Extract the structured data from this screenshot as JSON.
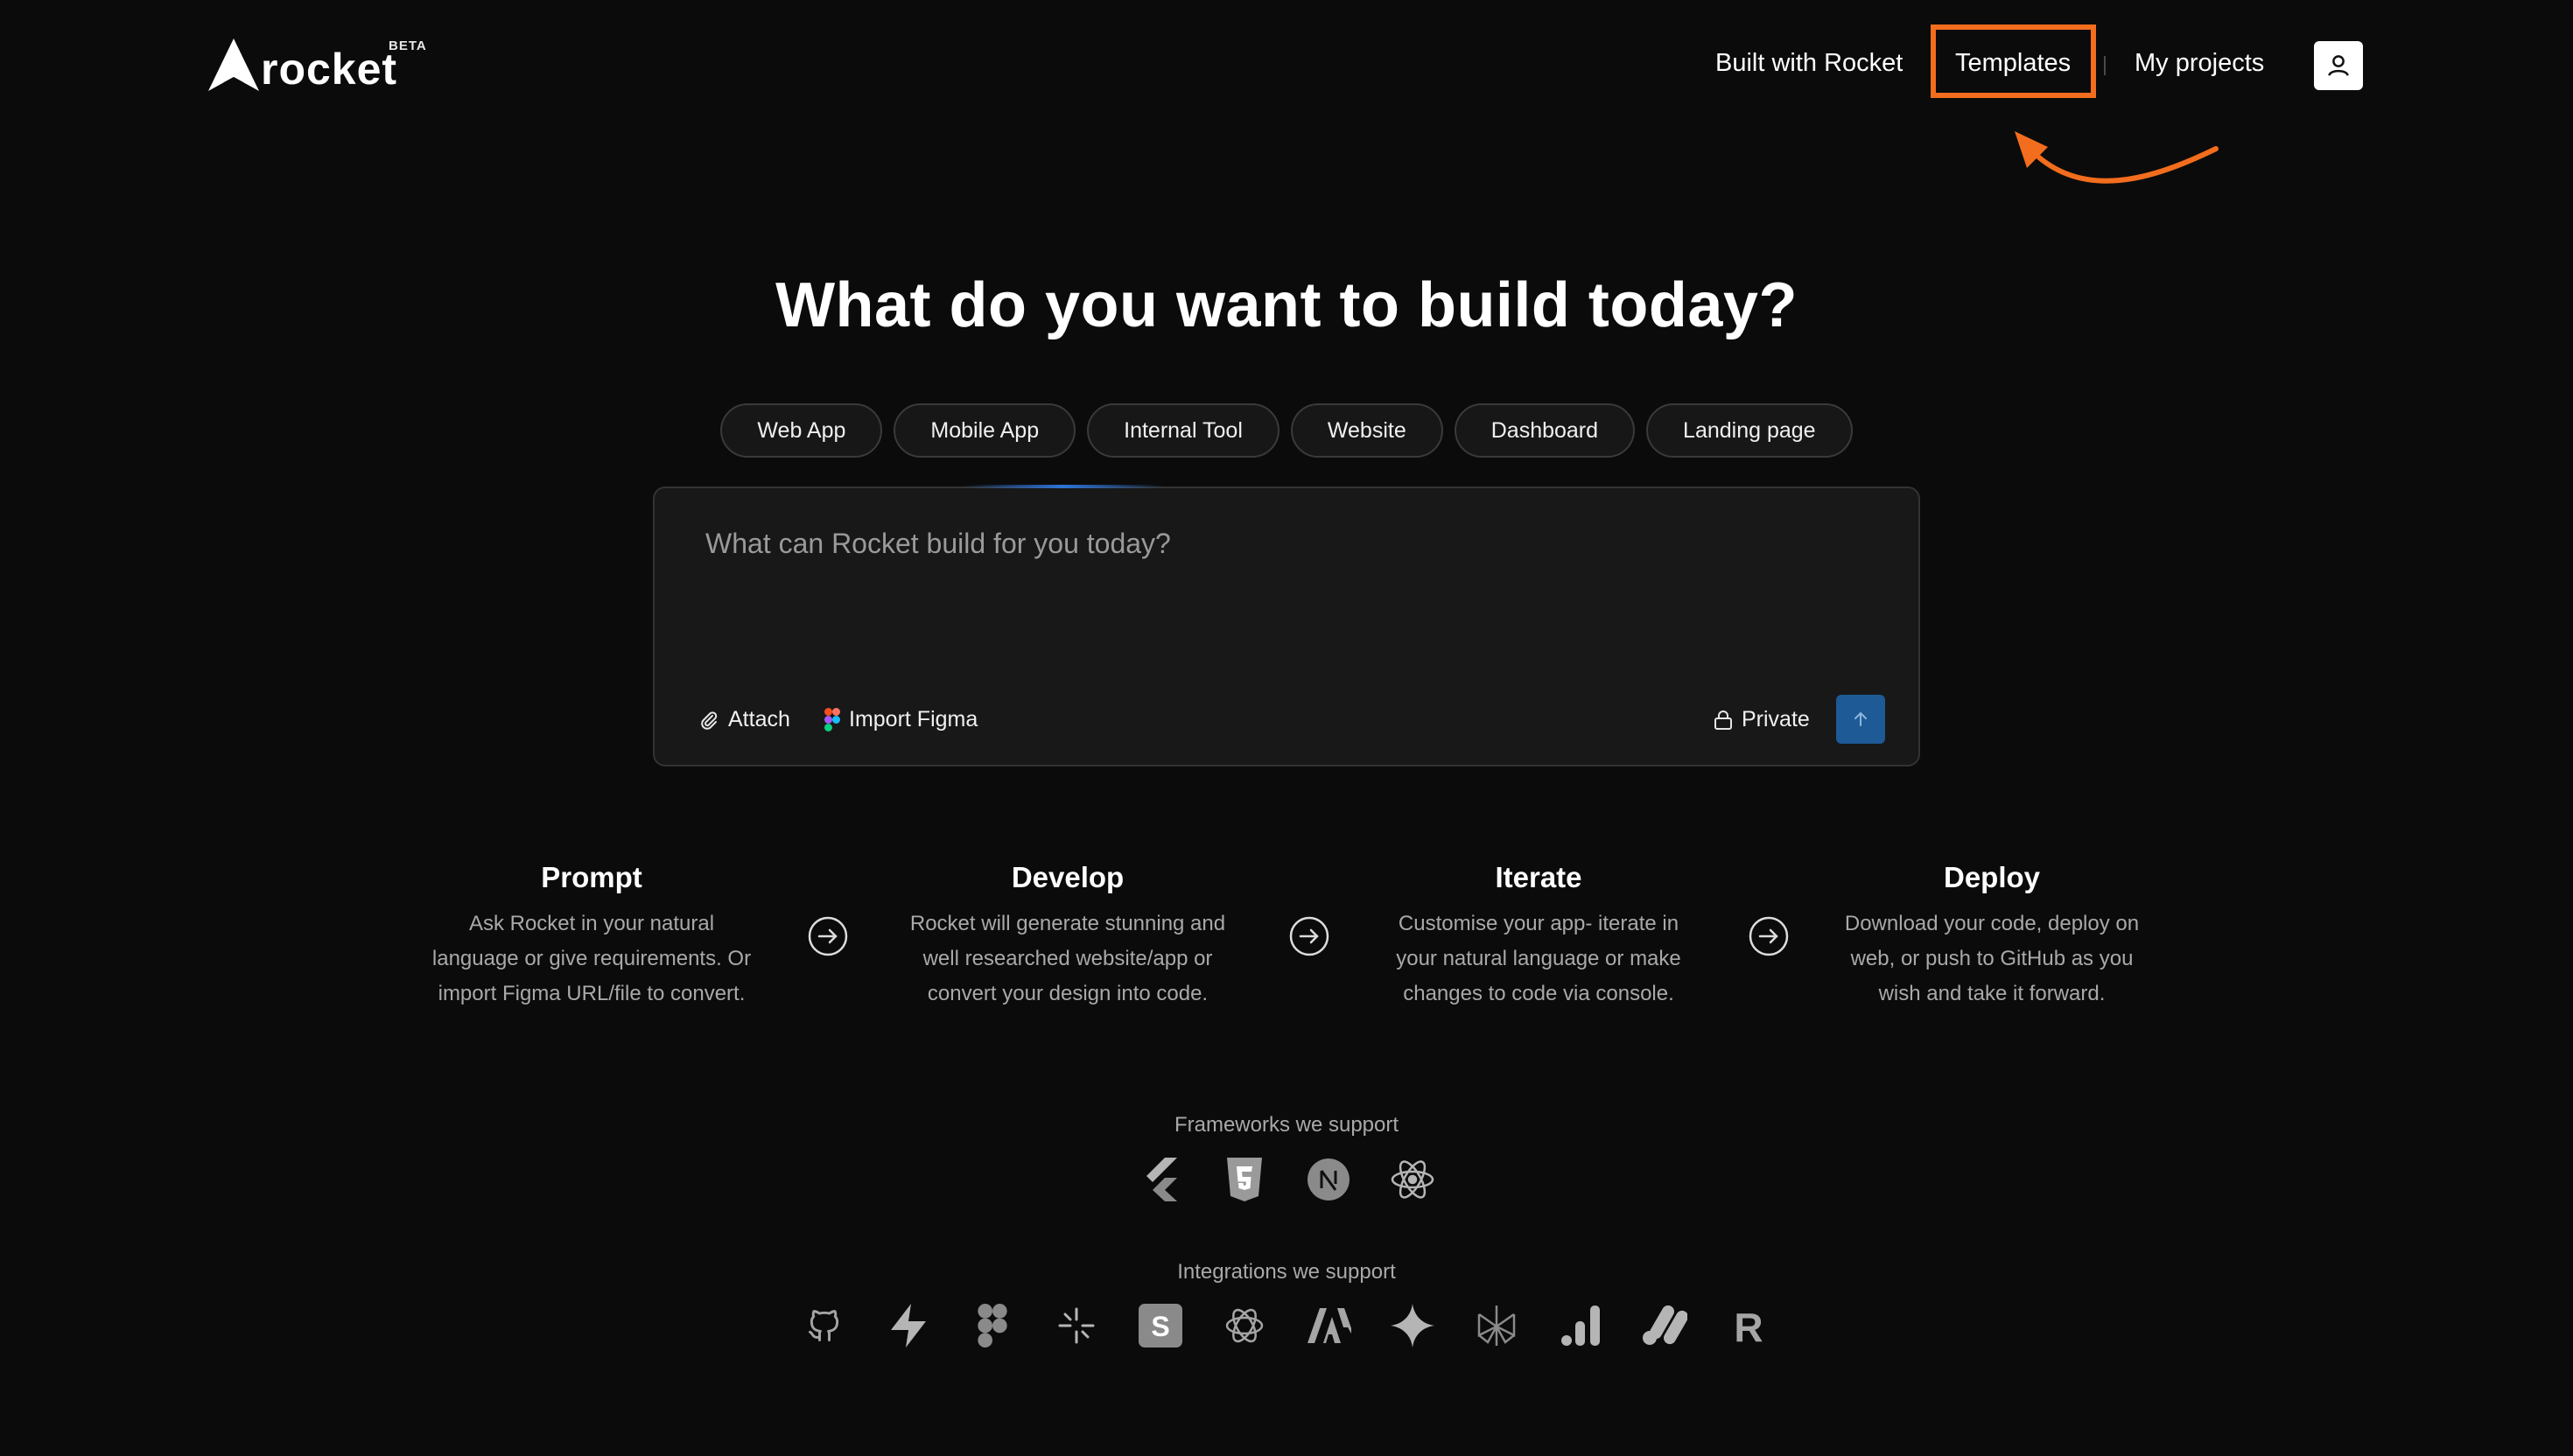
{
  "header": {
    "logo_text": "rocket",
    "beta_label": "BETA",
    "nav": {
      "built_with": "Built with Rocket",
      "templates": "Templates",
      "my_projects": "My projects"
    }
  },
  "hero": {
    "title": "What do you want to build today?",
    "chips": [
      "Web App",
      "Mobile App",
      "Internal Tool",
      "Website",
      "Dashboard",
      "Landing page"
    ]
  },
  "prompt": {
    "placeholder": "What can Rocket build for you today?",
    "attach_label": "Attach",
    "import_figma_label": "Import Figma",
    "private_label": "Private"
  },
  "steps": [
    {
      "title": "Prompt",
      "lines": [
        "Ask Rocket in your natural",
        "language or give requirements. Or",
        "import Figma URL/file to convert."
      ]
    },
    {
      "title": "Develop",
      "lines": [
        "Rocket will generate stunning and",
        "well researched website/app or",
        "convert your design into code."
      ]
    },
    {
      "title": "Iterate",
      "lines": [
        "Customise your app- iterate in",
        "your natural language or make",
        "changes to code via console."
      ]
    },
    {
      "title": "Deploy",
      "lines": [
        "Download your code, deploy on",
        "web, or push to GitHub as you",
        "wish and take it forward."
      ]
    }
  ],
  "frameworks": {
    "label": "Frameworks we support",
    "icons": [
      "flutter-icon",
      "html5-icon",
      "nextjs-icon",
      "react-icon"
    ]
  },
  "integrations": {
    "label": "Integrations we support",
    "icons": [
      "github-icon",
      "supabase-icon",
      "figma-icon",
      "perplexity-icon",
      "stripe-icon",
      "openai-icon",
      "anthropic-icon",
      "gemini-icon",
      "perplexity-ai-icon",
      "analytics-icon",
      "google-ads-icon",
      "resend-icon"
    ]
  },
  "colors": {
    "background": "#0b0b0b",
    "highlight": "#f26d1d",
    "send_button": "#1d5a96"
  }
}
